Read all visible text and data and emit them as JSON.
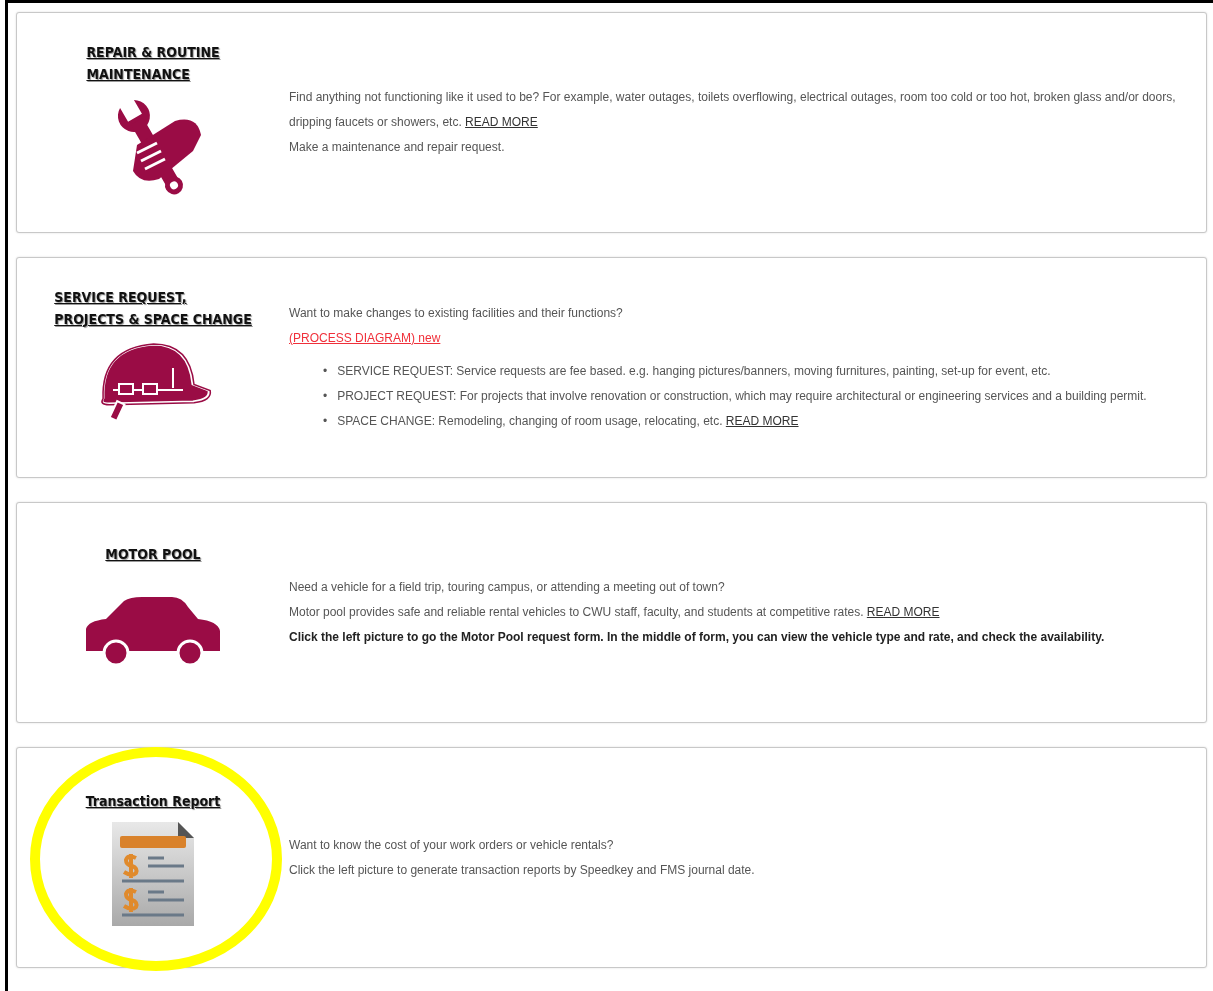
{
  "sections": [
    {
      "kind": "repair",
      "title_lines": [
        "REPAIR & ROUTINE",
        "MAINTENANCE"
      ],
      "highlighted": false,
      "paragraphs": [
        {
          "text": "Find anything not functioning like it used to be? For example, water outages, toilets overflowing, electrical outages, room too cold or too hot, broken glass and/or doors, dripping faucets or showers, etc. ",
          "link": "READ MORE",
          "bold": false
        },
        {
          "text": "Make a maintenance and repair request.",
          "bold": false
        }
      ]
    },
    {
      "kind": "service",
      "title_lines": [
        "SERVICE REQUEST,",
        "PROJECTS & SPACE CHANGE"
      ],
      "highlighted": false,
      "paragraphs": [
        {
          "text": "Want to make changes to existing facilities and their functions?",
          "bold": false
        },
        {
          "alert_link": "(PROCESS DIAGRAM) new"
        }
      ],
      "bullets": [
        {
          "marker": "•",
          "text": "SERVICE REQUEST: Service requests are fee based. e.g. hanging pictures/banners, moving furnitures, painting, set-up for event, etc."
        },
        {
          "marker": "•",
          "text": "PROJECT REQUEST: For projects that involve renovation or construction, which may require architectural or engineering services and a building permit."
        },
        {
          "marker": "•",
          "text": "SPACE CHANGE: Remodeling, changing of room usage, relocating, etc. ",
          "link": "READ MORE"
        }
      ]
    },
    {
      "kind": "motor",
      "title_lines": [
        "MOTOR POOL"
      ],
      "highlighted": false,
      "paragraphs": [
        {
          "text": "Need a vehicle for a field trip, touring campus, or attending a meeting out of town?",
          "bold": false
        },
        {
          "text": "Motor pool provides safe and reliable rental vehicles to CWU staff, faculty, and students at competitive rates. ",
          "link": "READ MORE",
          "bold": false
        },
        {
          "text": "Click the left picture to go the Motor Pool request form. In the middle of form, you can view the vehicle type and rate, and check the availability.",
          "bold": true
        }
      ]
    },
    {
      "kind": "report",
      "title_lines": [
        "Transaction Report"
      ],
      "highlighted": true,
      "paragraphs": [
        {
          "text": "Want to know the cost of your work orders or vehicle rentals?",
          "bold": false
        },
        {
          "text": "Click the left picture to generate transaction reports by Speedkey and FMS journal date.",
          "bold": false
        }
      ]
    }
  ]
}
